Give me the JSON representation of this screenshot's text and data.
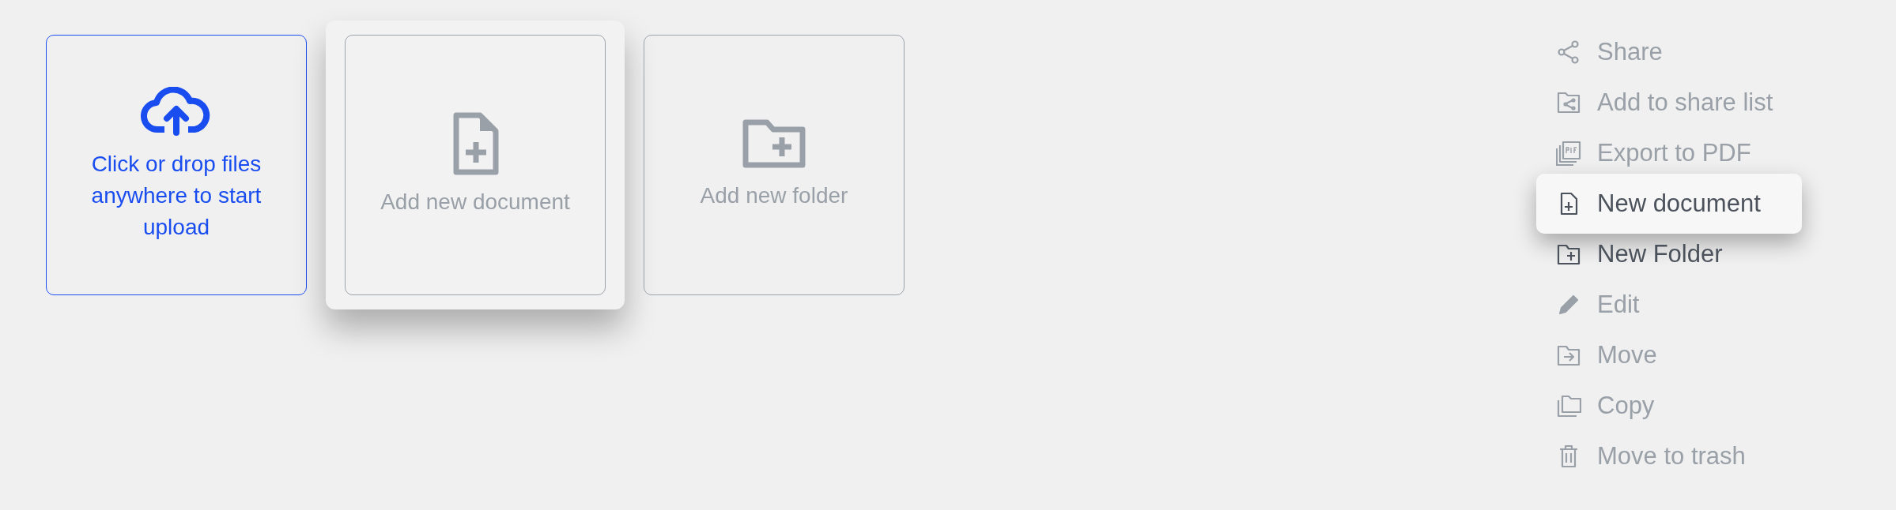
{
  "cards": [
    {
      "kind": "upload",
      "label": "Click or drop files anywhere to start upload",
      "lifted": false
    },
    {
      "kind": "document",
      "label": "Add new document",
      "lifted": true
    },
    {
      "kind": "folder",
      "label": "Add new folder",
      "lifted": false
    }
  ],
  "menu": [
    {
      "kind": "share",
      "label": "Share",
      "selected": false,
      "dimmed": true
    },
    {
      "kind": "share-list",
      "label": "Add to share list",
      "selected": false,
      "dimmed": true
    },
    {
      "kind": "pdf",
      "label": "Export to PDF",
      "selected": false,
      "dimmed": true
    },
    {
      "kind": "document",
      "label": "New document",
      "selected": true,
      "dimmed": false
    },
    {
      "kind": "folder",
      "label": "New Folder",
      "selected": false,
      "dimmed": false
    },
    {
      "kind": "edit",
      "label": "Edit",
      "selected": false,
      "dimmed": true
    },
    {
      "kind": "move",
      "label": "Move",
      "selected": false,
      "dimmed": true
    },
    {
      "kind": "copy",
      "label": "Copy",
      "selected": false,
      "dimmed": true
    },
    {
      "kind": "trash",
      "label": "Move to trash",
      "selected": false,
      "dimmed": true
    }
  ]
}
